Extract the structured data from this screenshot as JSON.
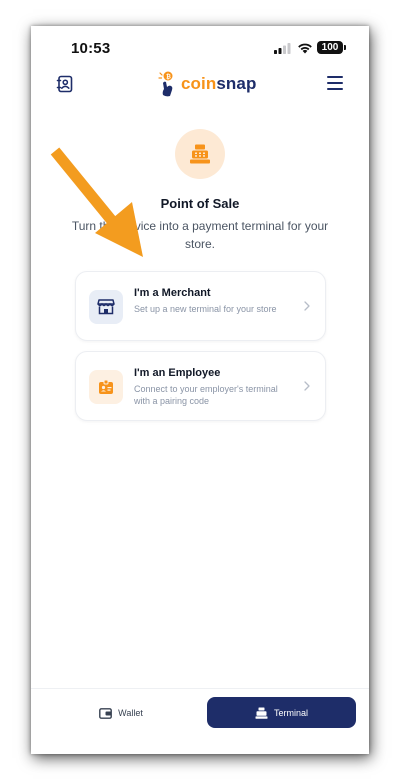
{
  "status_bar": {
    "time": "10:53",
    "battery": "100"
  },
  "header": {
    "logo_prefix": "coin",
    "logo_suffix": "snap"
  },
  "hero": {
    "title": "Point of Sale",
    "subtitle": "Turn this device into a payment terminal for your store."
  },
  "options": [
    {
      "title": "I'm a Merchant",
      "description": "Set up a new terminal for your store"
    },
    {
      "title": "I'm an Employee",
      "description": "Connect to your employer's terminal with a pairing code"
    }
  ],
  "nav": {
    "wallet_label": "Wallet",
    "terminal_label": "Terminal"
  },
  "colors": {
    "brand_navy": "#1e2d69",
    "brand_orange": "#f7931a",
    "annotation_arrow": "#f39c1f"
  }
}
